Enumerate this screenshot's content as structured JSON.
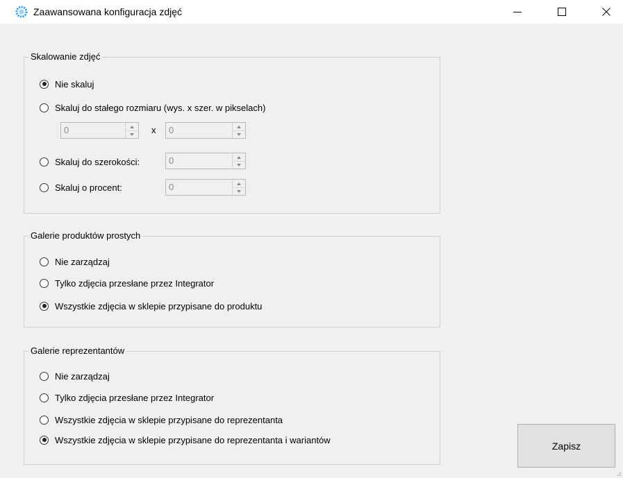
{
  "window": {
    "title": "Zaawansowana konfiguracja zdjęć",
    "accent_color": "#1e90ff"
  },
  "scaling": {
    "title": "Skalowanie zdjęć",
    "options": [
      {
        "label": "Nie skaluj",
        "checked": true
      },
      {
        "label": "Skaluj do stałego rozmiaru (wys. x szer. w pikselach)",
        "checked": false
      },
      {
        "label": "Skaluj do szerokości:",
        "checked": false
      },
      {
        "label": "Skaluj o procent:",
        "checked": false
      }
    ],
    "height_value": "0",
    "times_label": "x",
    "width_value": "0",
    "fit_width_value": "0",
    "percent_value": "0"
  },
  "simple_galleries": {
    "title": "Galerie produktów prostych",
    "options": [
      {
        "label": "Nie zarządzaj",
        "checked": false
      },
      {
        "label": "Tylko zdjęcia przesłane przez Integrator",
        "checked": false
      },
      {
        "label": "Wszystkie zdjęcia w sklepie przypisane do produktu",
        "checked": true
      }
    ]
  },
  "representative_galleries": {
    "title": "Galerie reprezentantów",
    "options": [
      {
        "label": "Nie zarządzaj",
        "checked": false
      },
      {
        "label": "Tylko zdjęcia przesłane przez Integrator",
        "checked": false
      },
      {
        "label": "Wszystkie zdjęcia w sklepie przypisane do reprezentanta",
        "checked": false
      },
      {
        "label": "Wszystkie zdjęcia w sklepie przypisane do reprezentanta i wariantów",
        "checked": true
      }
    ]
  },
  "save_button": {
    "label": "Zapisz"
  }
}
